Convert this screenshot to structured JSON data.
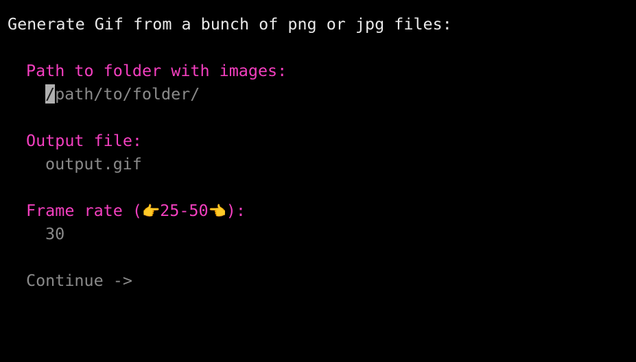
{
  "heading": "Generate Gif from a bunch of png or jpg files:",
  "fields": {
    "path": {
      "label": "Path to folder with images:",
      "placeholder_cursor_char": "/",
      "placeholder_rest": "path/to/folder/"
    },
    "output": {
      "label": "Output file:",
      "placeholder": "output.gif"
    },
    "frame_rate": {
      "label_prefix": "Frame rate (",
      "hand_right_icon": "👉",
      "range": "25-50",
      "hand_left_icon": "👈",
      "label_suffix": "):",
      "placeholder": "30"
    }
  },
  "continue_label": "Continue ->",
  "colors": {
    "label": "#f33fbf",
    "placeholder": "#8a8a8a",
    "heading": "#e8e8e8",
    "background": "#000000"
  }
}
